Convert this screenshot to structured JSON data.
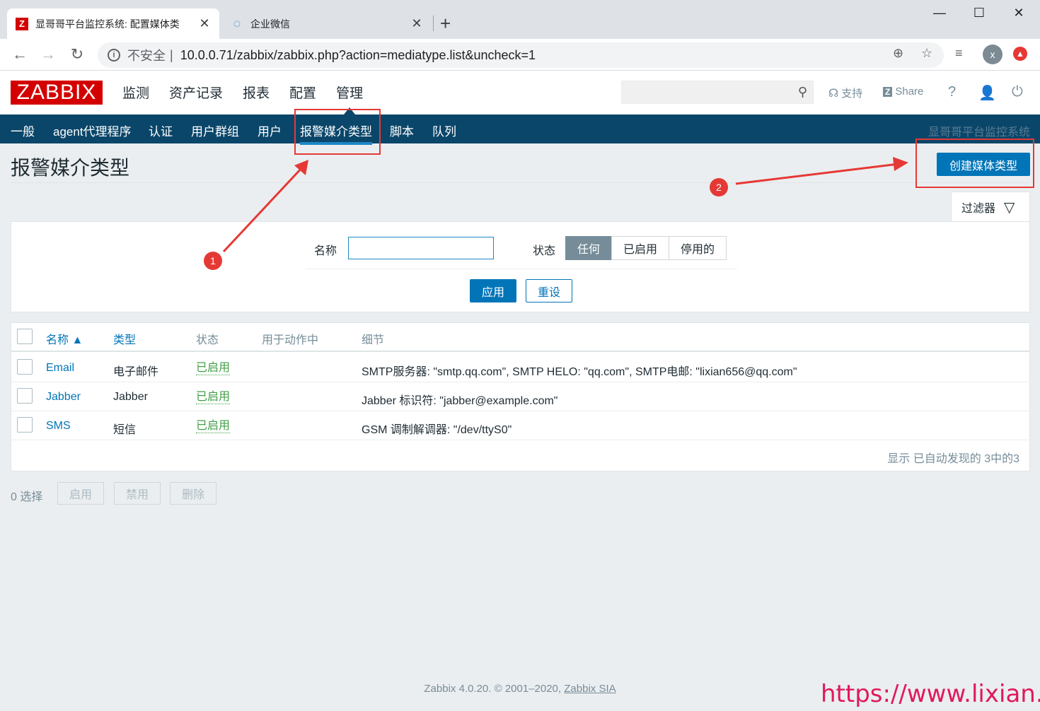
{
  "browser": {
    "tabs": [
      {
        "title": "显哥哥平台监控系统: 配置媒体类",
        "icon": "Z"
      },
      {
        "title": "企业微信"
      }
    ],
    "address": {
      "insecure_label": "不安全",
      "separator": "|",
      "url": "10.0.0.71/zabbix/zabbix.php?action=mediatype.list&uncheck=1"
    },
    "avatar_letter": "x"
  },
  "header": {
    "logo": "ZABBIX",
    "menu": [
      "监测",
      "资产记录",
      "报表",
      "配置",
      "管理"
    ],
    "support": "支持",
    "share": "Share",
    "help": "?"
  },
  "submenu": {
    "items": [
      "一般",
      "agent代理程序",
      "认证",
      "用户群组",
      "用户",
      "报警媒介类型",
      "脚本",
      "队列"
    ],
    "selected": "报警媒介类型",
    "brand": "显哥哥平台监控系统"
  },
  "page": {
    "title": "报警媒介类型",
    "create_button": "创建媒体类型"
  },
  "filter": {
    "tab_label": "过滤器",
    "name_label": "名称",
    "name_value": "",
    "status_label": "状态",
    "status_options": [
      "任何",
      "已启用",
      "停用的"
    ],
    "status_selected": "任何",
    "apply": "应用",
    "reset": "重设"
  },
  "table": {
    "columns": [
      "名称 ▲",
      "类型",
      "状态",
      "用于动作中",
      "细节"
    ],
    "rows": [
      {
        "name": "Email",
        "type": "电子邮件",
        "status": "已启用",
        "used": "",
        "details": "SMTP服务器: \"smtp.qq.com\", SMTP HELO: \"qq.com\", SMTP电邮: \"lixian656@qq.com\""
      },
      {
        "name": "Jabber",
        "type": "Jabber",
        "status": "已启用",
        "used": "",
        "details": "Jabber 标识符: \"jabber@example.com\""
      },
      {
        "name": "SMS",
        "type": "短信",
        "status": "已启用",
        "used": "",
        "details": "GSM 调制解调器: \"/dev/ttyS0\""
      }
    ],
    "footer": "显示 已自动发现的 3中的3"
  },
  "actions": {
    "selected_count": "0 选择",
    "buttons": [
      "启用",
      "禁用",
      "删除"
    ]
  },
  "footer": {
    "text": "Zabbix 4.0.20. © 2001–2020,",
    "link": "Zabbix SIA"
  },
  "watermark": "https://www.lixian.fun",
  "annotations": [
    "1",
    "2"
  ],
  "colors": {
    "accent": "#0275b8",
    "submenu_bg": "#0a466a",
    "logo_red": "#d40000",
    "status_green": "#429e47",
    "annotation_red": "#e53935"
  }
}
